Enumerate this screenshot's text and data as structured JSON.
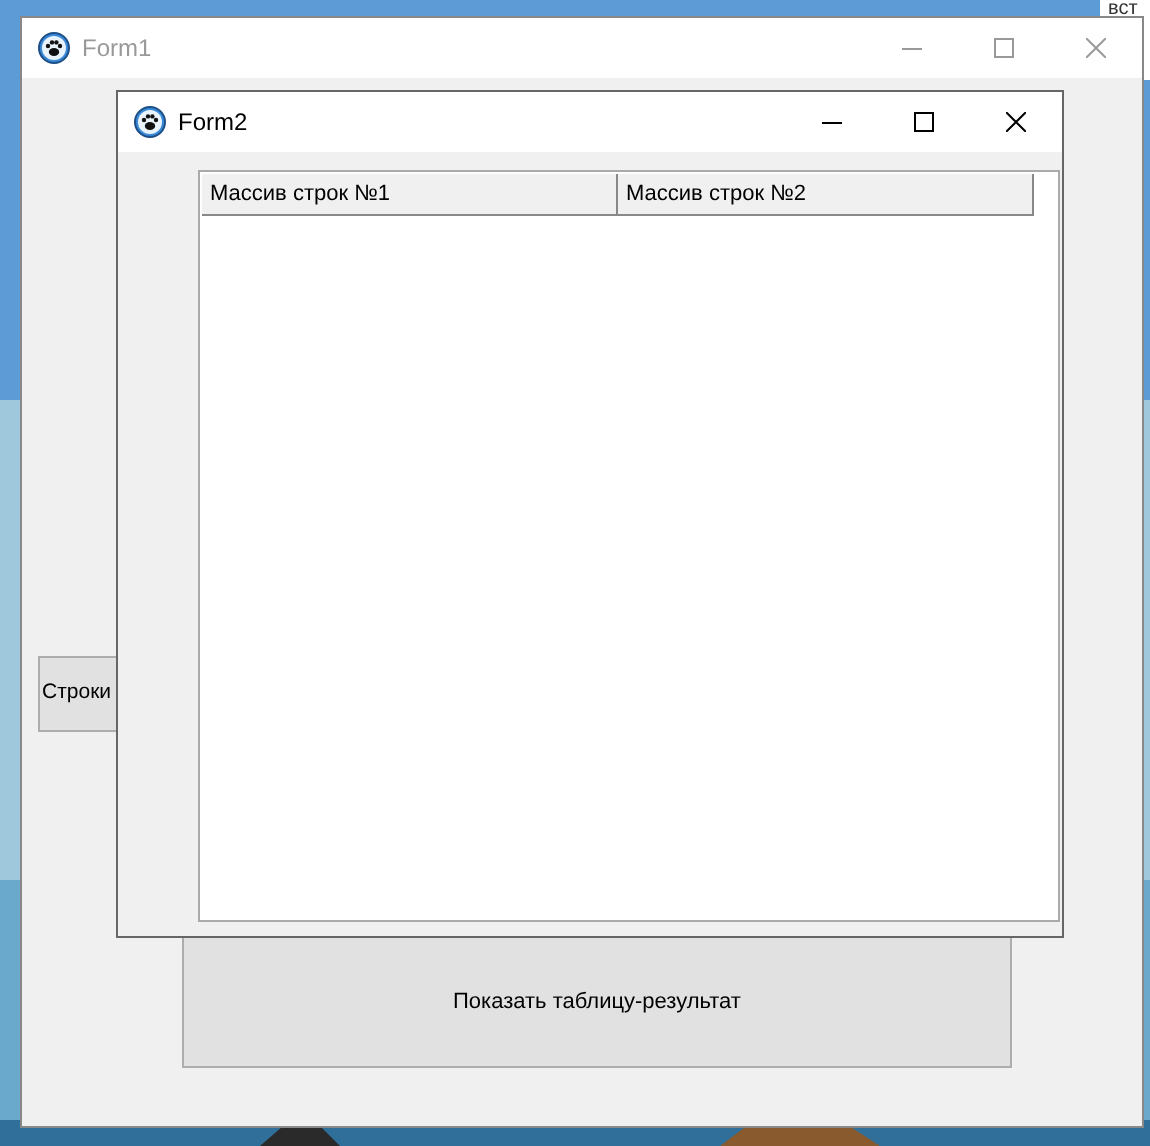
{
  "background_window": {
    "text": "вст"
  },
  "form1": {
    "title": "Form1",
    "active": false,
    "buttons": [
      {
        "label": "Строки"
      },
      {
        "label": "Показать таблицу-результат"
      }
    ]
  },
  "form2": {
    "title": "Form2",
    "active": true,
    "table": {
      "columns": [
        "Массив строк  №1",
        "Массив строк  №2"
      ]
    }
  }
}
